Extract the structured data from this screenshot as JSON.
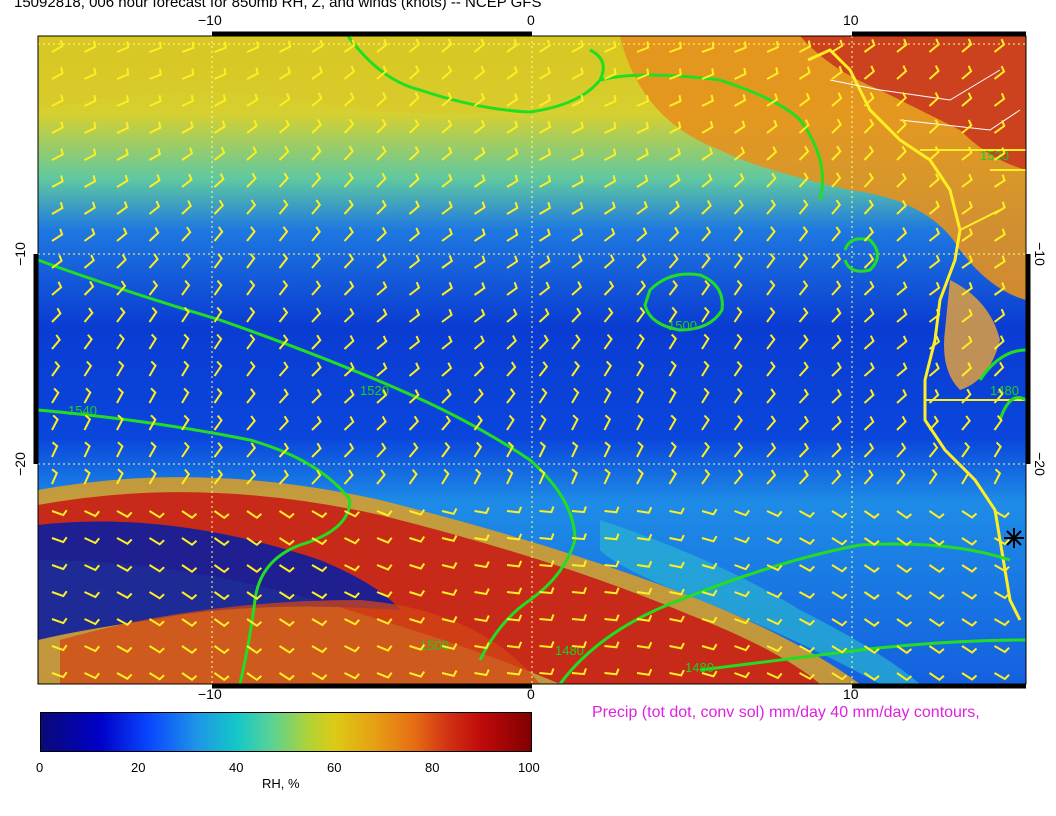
{
  "title": "15092818, 006 hour forecast for 850mb RH, Z, and winds (knots)  -- NCEP GFS",
  "map": {
    "x_ticks_top": [
      "−10",
      "0",
      "10"
    ],
    "x_ticks_bottom": [
      "−10",
      "0",
      "10"
    ],
    "y_ticks_left": [
      "−10",
      "−20"
    ],
    "y_ticks_right": [
      "−10",
      "−20"
    ],
    "contour_labels": [
      "1500",
      "1520",
      "1540",
      "1520",
      "1480",
      "1500",
      "1480",
      "1480"
    ],
    "colors": {
      "contour": "#22dd22",
      "barbs": "#ffee22",
      "coast": "#ffee22",
      "grid": "#ffff80",
      "precip_note": "#e020e0"
    }
  },
  "colorbar": {
    "ticks": [
      "0",
      "20",
      "40",
      "60",
      "80",
      "100"
    ],
    "label": "RH, %"
  },
  "precip_note": "Precip (tot dot, conv sol) mm/day 40 mm/day contours,"
}
